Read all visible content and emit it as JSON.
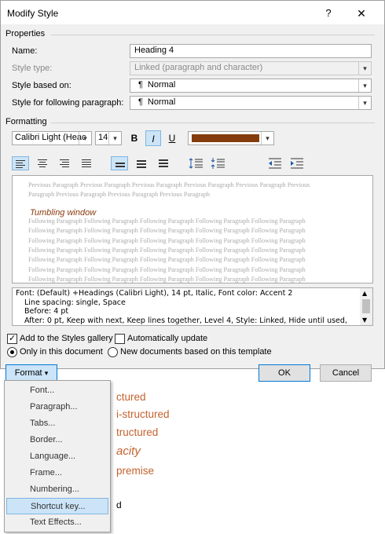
{
  "dialog": {
    "title": "Modify Style",
    "help": "?",
    "close": "✕"
  },
  "properties": {
    "section": "Properties",
    "name_label": "Name:",
    "name_value": "Heading 4",
    "type_label": "Style type:",
    "type_value": "Linked (paragraph and character)",
    "based_label": "Style based on:",
    "based_value": "Normal",
    "following_label": "Style for following paragraph:",
    "following_value": "Normal",
    "para_glyph": "¶"
  },
  "formatting": {
    "section": "Formatting",
    "font": "Calibri Light (Heac",
    "size": "14",
    "bold": "B",
    "italic": "I",
    "underline": "U",
    "font_color": "#843c0c"
  },
  "preview": {
    "previous": "Previous Paragraph Previous Paragraph Previous Paragraph Previous Paragraph Previous Paragraph Previous Paragraph Previous Paragraph Previous Paragraph Previous Paragraph",
    "heading": "Tumbling window",
    "following_line": "Following Paragraph Following Paragraph Following Paragraph Following Paragraph Following Paragraph"
  },
  "description": {
    "line1": "Font: (Default) +Headings (Calibri Light), 14 pt, Italic, Font color: Accent 2",
    "line2": "Line spacing:  single, Space",
    "line3": "Before:  4 pt",
    "line4": "After:  0 pt, Keep with next, Keep lines together, Level 4, Style: Linked, Hide until used,"
  },
  "options": {
    "add_gallery": "Add to the Styles gallery",
    "auto_update": "Automatically update",
    "only_doc": "Only in this document",
    "new_docs": "New documents based on this template"
  },
  "buttons": {
    "format": "Format",
    "format_arrow": "▾",
    "ok": "OK",
    "cancel": "Cancel"
  },
  "format_menu": [
    "Font...",
    "Paragraph...",
    "Tabs...",
    "Border...",
    "Language...",
    "Frame...",
    "Numbering...",
    "Shortcut key...",
    "Text Effects..."
  ],
  "background": {
    "line1": "ctured",
    "line2": "i-structured",
    "line3": "tructured",
    "line4": "acity",
    "line5": "premise",
    "line6": "d"
  }
}
